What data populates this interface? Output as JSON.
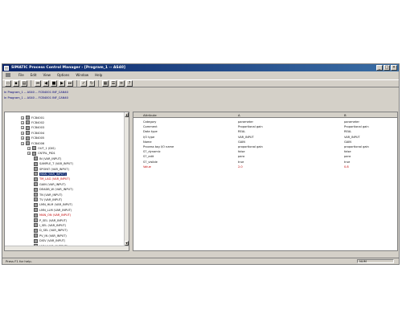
{
  "window": {
    "title": "SIMATIC Process Control Manager - [Program_1 -- AS40]",
    "controls": [
      "_",
      "□",
      "×"
    ]
  },
  "menu": [
    "File",
    "Edit",
    "View",
    "Options",
    "Window",
    "Help"
  ],
  "toolbar": {
    "buttons": [
      "open-icon",
      "save-icon",
      "print-icon",
      "first-icon",
      "prev-icon",
      "stop-icon",
      "next-icon",
      "last-icon",
      "check-icon",
      "refresh-icon",
      "view-icon",
      "detail-icon",
      "list-icon",
      "help-icon"
    ]
  },
  "paths": [
    "In Program_1 -- AS40 -- FCB4001 INF_CAN40",
    "In Program_1 -- AS40 -- FCB4001 INF_CAN40"
  ],
  "tree": {
    "rows": [
      {
        "label": "FCB4001",
        "style": "normal"
      },
      {
        "label": "FCB4002",
        "style": "normal"
      },
      {
        "label": "FCB4003",
        "style": "normal"
      },
      {
        "label": "FCB4004",
        "style": "normal"
      },
      {
        "label": "FCB4005",
        "style": "normal"
      },
      {
        "label": "FCB4006",
        "style": "normal"
      },
      {
        "label": "OUT_1 (DIS)",
        "style": "normal"
      },
      {
        "label": "CNTRL_PID1",
        "style": "normal"
      },
      {
        "label": "IN (VAR_INPUT)",
        "style": "normal"
      },
      {
        "label": "SAMPLE_T (VAR_INPUT)",
        "style": "normal"
      },
      {
        "label": "SPOINT (VAR_INPUT)",
        "style": "normal"
      },
      {
        "label": "MAN (VAR_INPUT)",
        "style": "selected"
      },
      {
        "label": "TM_LAG (VAR_INPUT)",
        "style": "red"
      },
      {
        "label": "GAIN (VAR_INPUT)",
        "style": "normal"
      },
      {
        "label": "DEADB_W (VAR_INPUT)",
        "style": "normal"
      },
      {
        "label": "TN (VAR_INPUT)",
        "style": "normal"
      },
      {
        "label": "TV (VAR_INPUT)",
        "style": "normal"
      },
      {
        "label": "LMN_HLM (VAR_INPUT)",
        "style": "normal"
      },
      {
        "label": "LMN_LLM (VAR_INPUT)",
        "style": "normal"
      },
      {
        "label": "MAN_ON (VAR_INPUT)",
        "style": "red"
      },
      {
        "label": "P_SEL (VAR_INPUT)",
        "style": "normal"
      },
      {
        "label": "I_SEL (VAR_INPUT)",
        "style": "normal"
      },
      {
        "label": "D_SEL (VAR_INPUT)",
        "style": "normal"
      },
      {
        "label": "PV_IN (VAR_INPUT)",
        "style": "normal"
      },
      {
        "label": "DISV (VAR_INPUT)",
        "style": "normal"
      },
      {
        "label": "LMN (VAR_OUTPUT)",
        "style": "normal"
      }
    ]
  },
  "grid": {
    "headers": [
      "Attribute",
      "A",
      "B"
    ],
    "rows": [
      {
        "attr": "Category",
        "a": "parameter",
        "b": "parameter",
        "style": "normal"
      },
      {
        "attr": "Comment",
        "a": "Proportional gain",
        "b": "Proportional gain",
        "style": "normal"
      },
      {
        "attr": "Data type",
        "a": "REAL",
        "b": "REAL",
        "style": "normal"
      },
      {
        "attr": "I/O type",
        "a": "VAR_INPUT",
        "b": "VAR_INPUT",
        "style": "normal"
      },
      {
        "attr": "Name",
        "a": "GAIN",
        "b": "GAIN",
        "style": "normal"
      },
      {
        "attr": "Process tag I/O name",
        "a": "proportional gain",
        "b": "proportional gain",
        "style": "normal"
      },
      {
        "attr": "S7_dynamic",
        "a": "false",
        "b": "false",
        "style": "normal"
      },
      {
        "attr": "S7_edit",
        "a": "para",
        "b": "para",
        "style": "normal"
      },
      {
        "attr": "S7_visible",
        "a": "true",
        "b": "true",
        "style": "normal"
      },
      {
        "attr": "Value",
        "a": "2.0",
        "b": "0.8",
        "style": "red"
      }
    ]
  },
  "status": {
    "text": "Press F1 for help.",
    "indicator": "NUM"
  }
}
